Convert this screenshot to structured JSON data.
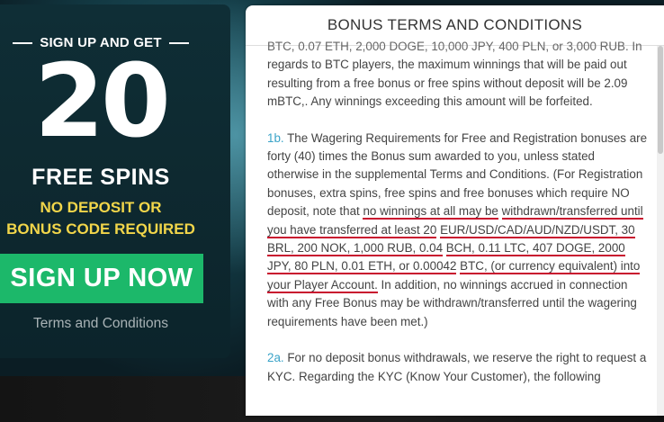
{
  "promo": {
    "kicker": "SIGN UP AND GET",
    "big_number": "20",
    "free_spins": "FREE SPINS",
    "condition_line1": "NO DEPOSIT OR",
    "condition_line2": "BONUS CODE REQUIRED",
    "signup_button": "SIGN UP NOW",
    "terms_link": "Terms and Conditions"
  },
  "terms_panel": {
    "title": "BONUS TERMS AND CONDITIONS",
    "cut_line": "BTC, 0.07 ETH, 2,000 DOGE, 10,000 JPY, 400 PLN, or 3,000 RUB. In",
    "para_top_rest": "regards to BTC players, the maximum winnings that will be paid out resulting from a free bonus or free spins without deposit will be 2.09 mBTC,. Any winnings exceeding this amount will be forfeited.",
    "section_1b": {
      "number": "1b.",
      "text_before": "The Wagering Requirements for Free and Registration bonuses are forty (40) times the Bonus sum awarded to you, unless stated otherwise in the supplemental Terms and Conditions. (For Registration bonuses, extra spins, free spins and free bonuses which require NO deposit, note that",
      "underlined_1": "no winnings at all may be",
      "underlined_2": "withdrawn/transferred until you have transferred at least 20",
      "underlined_3": "EUR/USD/CAD/AUD/NZD/USDT, 30 BRL, 200 NOK, 1,000 RUB, 0.04",
      "underlined_4": "BCH, 0.11 LTC, 407 DOGE, 2000 JPY, 80 PLN, 0.01 ETH, or 0.00042",
      "underlined_5": "BTC, (or currency equivalent) into your Player Account.",
      "text_after": "In addition, no winnings accrued in connection with any Free Bonus may be withdrawn/transferred until the wagering requirements have been met.)"
    },
    "section_2a": {
      "number": "2a.",
      "text": "For no deposit bonus withdrawals, we reserve the right to request a KYC. Regarding the KYC (Know Your Customer), the following"
    }
  },
  "colors": {
    "accent_green": "#1cb86a",
    "accent_yellow": "#f2d64a",
    "section_number_blue": "#3aa3c8",
    "underline_red": "#c8102e"
  }
}
